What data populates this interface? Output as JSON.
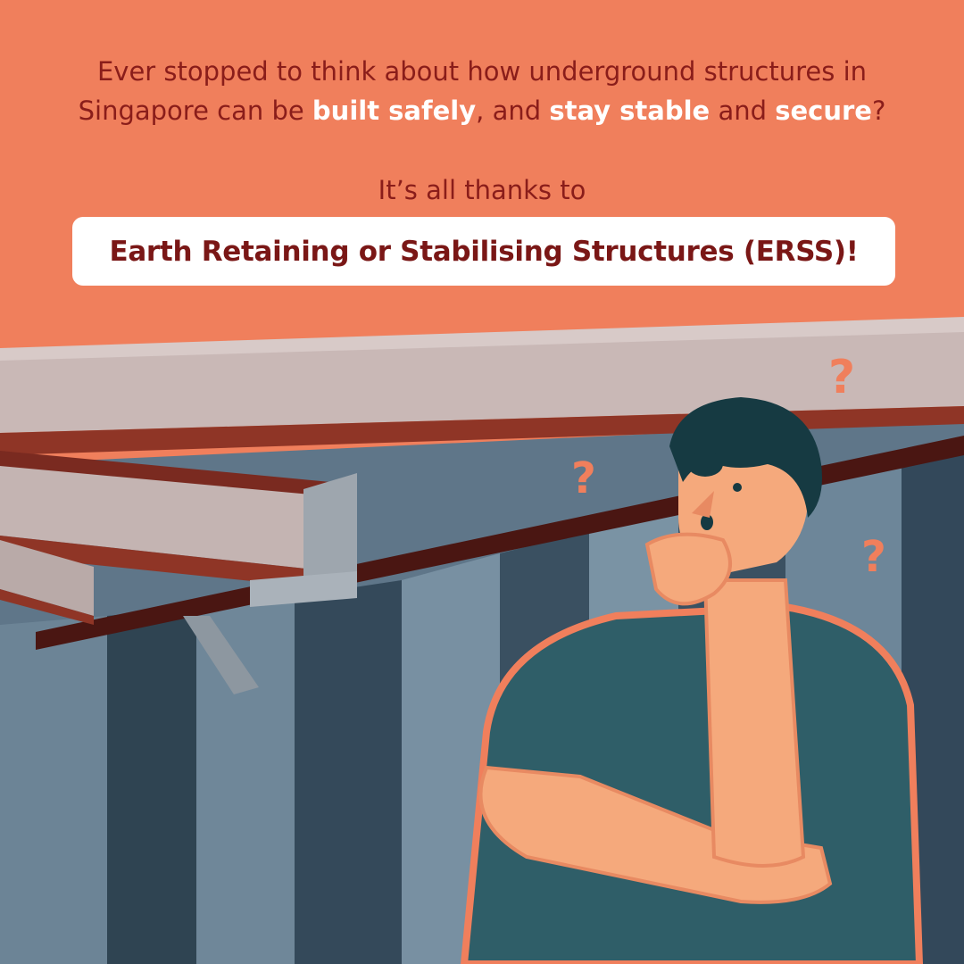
{
  "intro": {
    "part1": "Ever stopped to think about how underground structures in Singapore can be ",
    "highlight1": "built safely",
    "part2": ", and ",
    "highlight2": "stay stable",
    "part3": " and ",
    "highlight3": "secure",
    "part4": "?"
  },
  "thanks_line": "It’s all thanks to",
  "banner_text": "Earth Retaining or Stabilising Structures (ERSS)!",
  "question_marks": [
    "?",
    "?",
    "?"
  ],
  "colors": {
    "background": "#f07f5c",
    "heading_text": "#8a1d1a",
    "highlight_text": "#ffffff",
    "banner_bg": "#ffffff",
    "banner_text": "#7a1716",
    "wall": "#5d7488",
    "beam": "#c9b8b6",
    "beam_underside": "#8f3526",
    "shirt": "#2f5e68",
    "skin": "#f5a97c",
    "hair": "#163a42"
  }
}
